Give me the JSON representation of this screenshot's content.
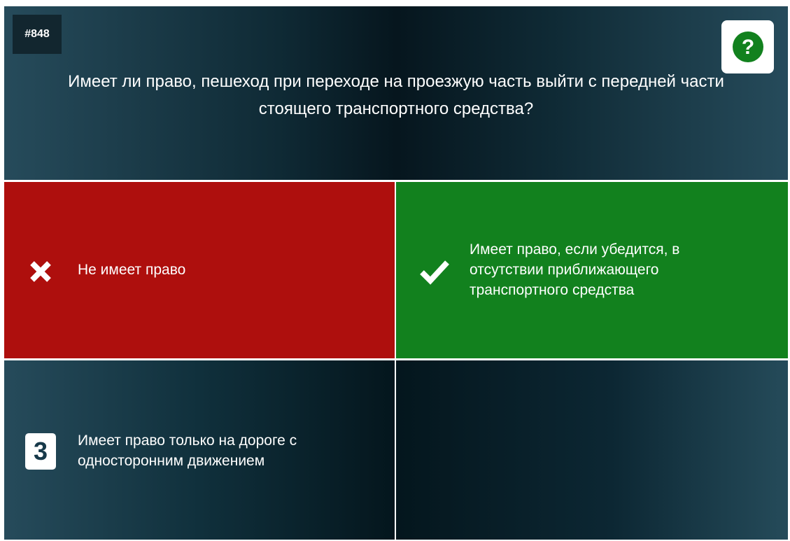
{
  "question": {
    "number": "#848",
    "text": "Имеет ли право, пешеход при переходе на проезжую часть выйти с передней части стоящего транспортного средства?",
    "help_icon": "question-circle-icon"
  },
  "answers": [
    {
      "label": "Не имеет право",
      "state": "wrong",
      "icon": "cross-icon",
      "color": "#ae0f0d"
    },
    {
      "label": "Имеет право, если убедится, в отсутствии приближающего транспортного средства",
      "state": "correct",
      "icon": "check-icon",
      "color": "#12811e"
    },
    {
      "label": "Имеет право только на дороге с односторонним движением",
      "state": "neutral",
      "number": "3"
    }
  ],
  "colors": {
    "wrong": "#ae0f0d",
    "correct": "#12811e",
    "dark": "#06161e",
    "help_circle": "#12811e"
  }
}
